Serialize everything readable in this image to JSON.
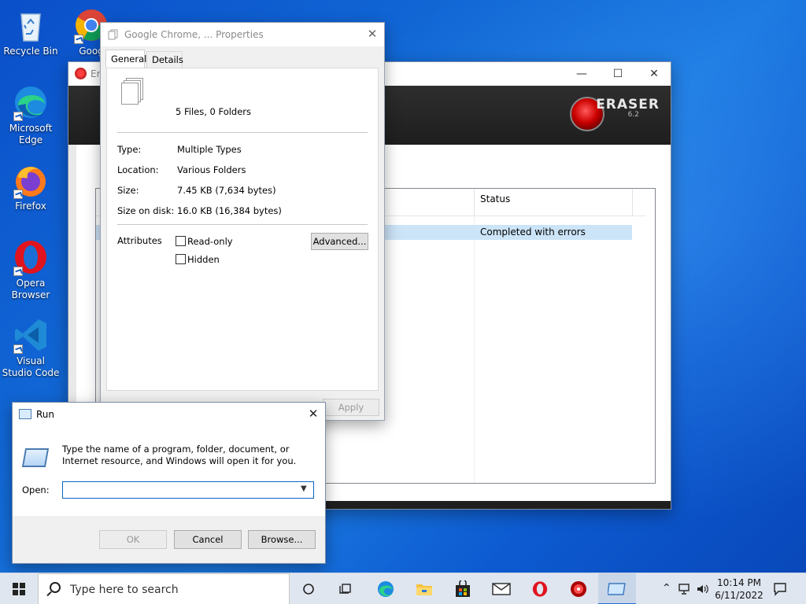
{
  "desktop": {
    "icons": [
      {
        "label": "Recycle Bin"
      },
      {
        "label": "Goog"
      },
      {
        "label": "Microsoft Edge"
      },
      {
        "label": "Firefox"
      },
      {
        "label": "Opera Browser"
      },
      {
        "label": "Visual Studio Code"
      }
    ]
  },
  "eraser": {
    "title": "Era",
    "brand": "ERASER",
    "version": "6.2",
    "list": {
      "status_header": "Status",
      "rows": [
        {
          "status": "Completed with errors"
        }
      ]
    }
  },
  "properties": {
    "title": "Google Chrome, ... Properties",
    "tabs": [
      {
        "label": "General"
      },
      {
        "label": "Details"
      }
    ],
    "summary": "5 Files, 0 Folders",
    "fields": {
      "type_label": "Type:",
      "type_value": "Multiple Types",
      "location_label": "Location:",
      "location_value": "Various Folders",
      "size_label": "Size:",
      "size_value": "7.45 KB (7,634 bytes)",
      "disk_label": "Size on disk:",
      "disk_value": "16.0 KB (16,384 bytes)"
    },
    "attributes_label": "Attributes",
    "readonly_label": "Read-only",
    "hidden_label": "Hidden",
    "advanced_label": "Advanced...",
    "apply_label": "Apply"
  },
  "run": {
    "title": "Run",
    "description": "Type the name of a program, folder, document, or Internet resource, and Windows will open it for you.",
    "open_label": "Open:",
    "open_value": "",
    "ok_label": "OK",
    "cancel_label": "Cancel",
    "browse_label": "Browse..."
  },
  "taskbar": {
    "search_placeholder": "Type here to search",
    "time": "10:14 PM",
    "date": "6/11/2022"
  }
}
